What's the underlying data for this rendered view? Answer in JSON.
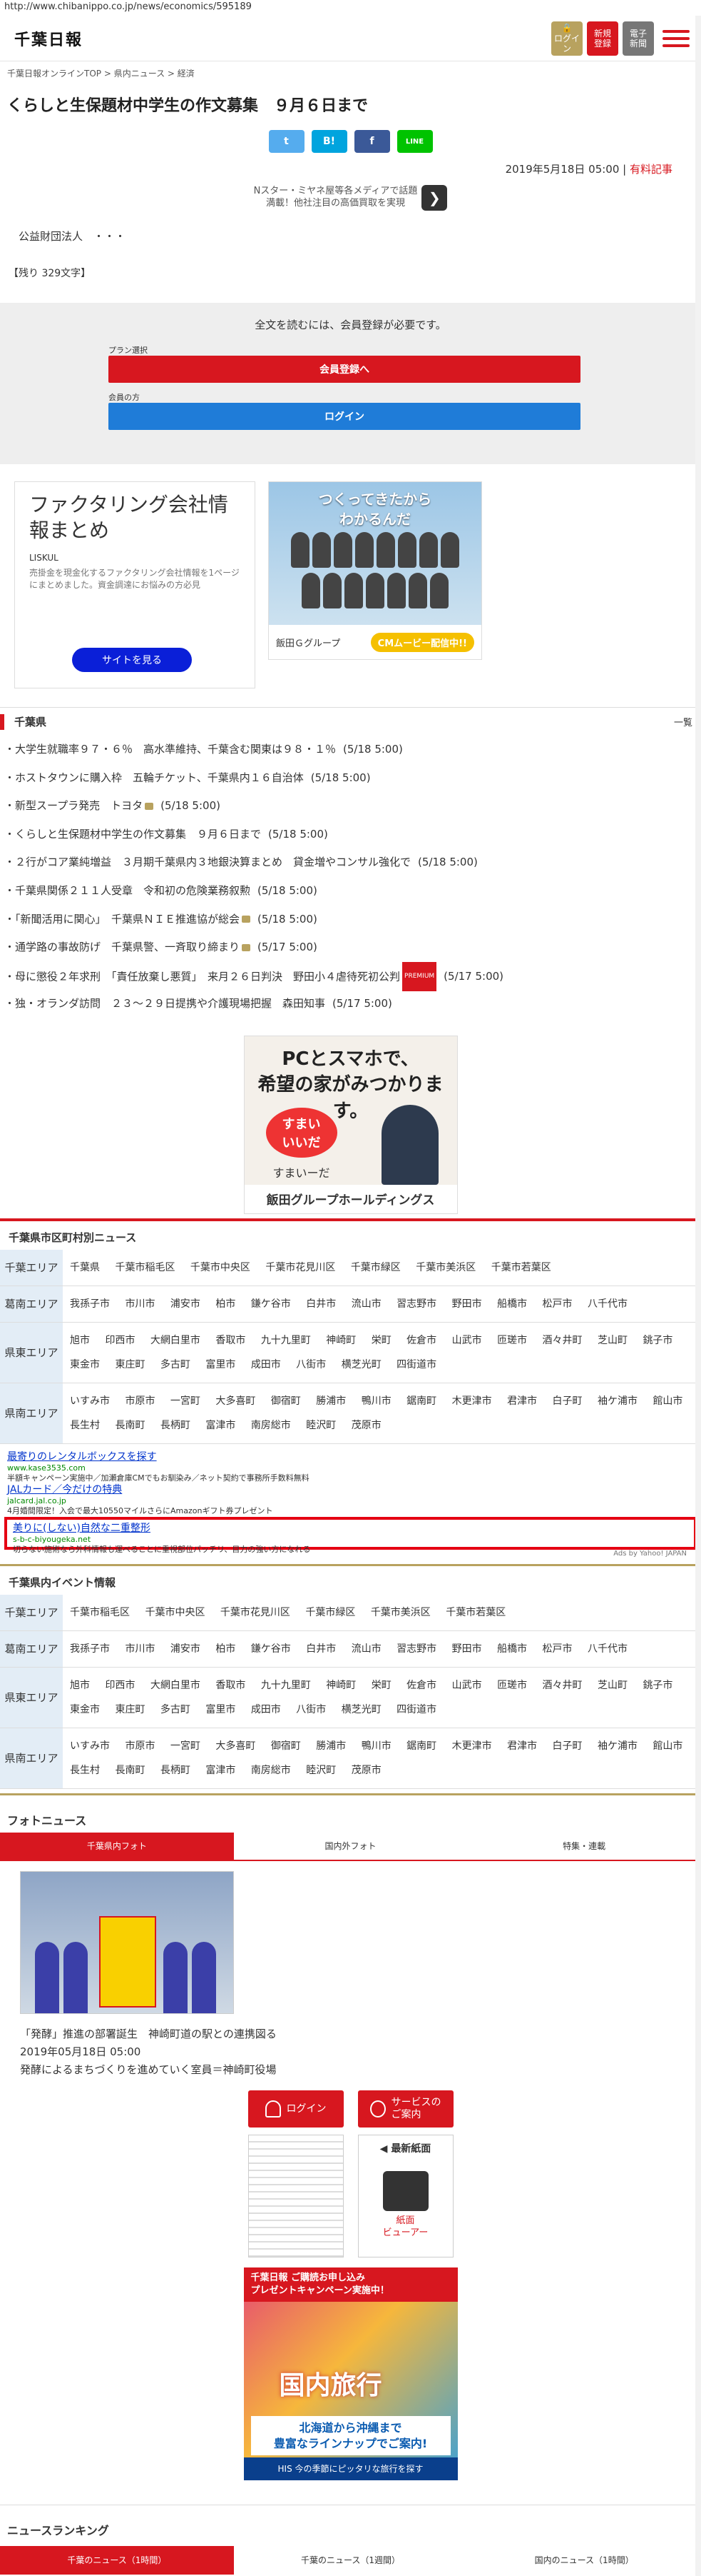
{
  "url": "http://www.chibanippo.co.jp/news/economics/595189",
  "logo": "千葉日報",
  "header": {
    "login": "ログイン",
    "register": "新規\n登録",
    "paper": "電子\n新聞"
  },
  "breadcrumb": "千葉日報オンラインTOP > 県内ニュース > 経済",
  "title": "くらしと生保題材中学生の作文募集　９月６日まで",
  "shares": [
    "t",
    "B!",
    "f",
    "LINE"
  ],
  "date": "2019年5月18日 05:00",
  "paid": "有料記事",
  "top_ad": {
    "line1": "Nスター・ミヤネ屋等各メディアで話題",
    "line2": "満載！他社注目の高価買取を実現"
  },
  "org": "公益財団法人　・・・",
  "remain": "【残り 329文字】",
  "member": {
    "notice": "全文を読むには、会員登録が必要です。",
    "plan_label": "プラン選択",
    "register_btn": "会員登録へ",
    "member_label": "会員の方",
    "login_btn": "ログイン"
  },
  "ad_factoring": {
    "title": "ファクタリング会社情報まとめ",
    "src": "LISKUL",
    "desc": "売掛金を現金化するファクタリング会社情報を1ページにまとめました。資金調達にお悩みの方必見",
    "btn": "サイトを見る"
  },
  "ad_iida": {
    "head": "つくってきたから\nわかるんだ",
    "brand": "飯田Ｇグループ",
    "cm": "CMムービー配信中!!"
  },
  "chiba": {
    "head": "千葉県",
    "more": "一覧",
    "items": [
      {
        "t": "大学生就職率９７・６％　高水準維持、千葉含む関東は９８・１％",
        "d": "(5/18 5:00)",
        "i": ""
      },
      {
        "t": "ホストタウンに購入枠　五輪チケット、千葉県内１６自治体",
        "d": "(5/18 5:00)",
        "i": ""
      },
      {
        "t": "新型スープラ発売　トヨタ",
        "d": "(5/18 5:00)",
        "i": "cam"
      },
      {
        "t": "くらしと生保題材中学生の作文募集　９月６日まで",
        "d": "(5/18 5:00)",
        "i": ""
      },
      {
        "t": "２行がコア業純増益　３月期千葉県内３地銀決算まとめ　貸金増やコンサル強化で",
        "d": "(5/18 5:00)",
        "i": ""
      },
      {
        "t": "千葉県関係２１１人受章　令和初の危険業務叙勲",
        "d": "(5/18 5:00)",
        "i": ""
      },
      {
        "t": "「新聞活用に関心」　千葉県ＮＩＥ推進協が総会",
        "d": "(5/18 5:00)",
        "i": "cam"
      },
      {
        "t": "通学路の事故防げ　千葉県警、一斉取り締まり",
        "d": "(5/17 5:00)",
        "i": "cam"
      },
      {
        "t": "母に懲役２年求刑　「責任放棄し悪質」　来月２６日判決　野田小４虐待死初公判",
        "d": "(5/17 5:00)",
        "i": "premium"
      },
      {
        "t": "独・オランダ訪問　２３～２９日提携や介護現場把握　森田知事",
        "d": "(5/17 5:00)",
        "i": ""
      }
    ],
    "premium": "PREMIUM"
  },
  "ad_iida2": {
    "head": "PCとスマホで、\n希望の家がみつかります。",
    "sumai": "すまい\nいいだ",
    "sumai_txt": "すまいーだ",
    "foot": "飯田グループホールディングス"
  },
  "areas1": {
    "head": "千葉県市区町村別ニュース",
    "rows": [
      {
        "label": "千葉エリア",
        "cells": [
          "千葉県",
          "千葉市稲毛区",
          "千葉市中央区",
          "千葉市花見川区",
          "千葉市緑区",
          "千葉市美浜区",
          "千葉市若葉区"
        ]
      },
      {
        "label": "葛南エリア",
        "cells": [
          "我孫子市",
          "市川市",
          "浦安市",
          "柏市",
          "鎌ケ谷市",
          "白井市",
          "流山市",
          "習志野市",
          "野田市",
          "船橋市",
          "松戸市",
          "八千代市"
        ]
      },
      {
        "label": "県東エリア",
        "cells": [
          "旭市",
          "印西市",
          "大網白里市",
          "香取市",
          "九十九里町",
          "神崎町",
          "栄町",
          "佐倉市",
          "山武市",
          "匝瑳市",
          "酒々井町",
          "芝山町",
          "銚子市",
          "東金市",
          "東庄町",
          "多古町",
          "富里市",
          "成田市",
          "八街市",
          "横芝光町",
          "四街道市"
        ]
      },
      {
        "label": "県南エリア",
        "cells": [
          "いすみ市",
          "市原市",
          "一宮町",
          "大多喜町",
          "御宿町",
          "勝浦市",
          "鴨川市",
          "鋸南町",
          "木更津市",
          "君津市",
          "白子町",
          "袖ケ浦市",
          "館山市",
          "長生村",
          "長南町",
          "長柄町",
          "富津市",
          "南房総市",
          "睦沢町",
          "茂原市"
        ]
      }
    ]
  },
  "yads": [
    {
      "h": "最寄りのレンタルボックスを探す",
      "u": "www.kase3535.com",
      "d": "半額キャンペーン実施中／加瀬倉庫CMでもお馴染み／ネット契約で事務所手数料無料"
    },
    {
      "h": "JALカード／今だけの特典",
      "u": "jalcard.jal.co.jp",
      "d": "4月婚間限定！入会で最大10550マイルさらにAmazonギフト券プレゼント"
    },
    {
      "h": "美りに(しない)自然な二重整形",
      "u": "s-b-c-biyougeka.net",
      "d": "切らない施術なら外科情報も運べることに重視部位パッチリ、目力の強い方になれる"
    }
  ],
  "ads_by": "Ads by Yahoo! JAPAN",
  "areas2": {
    "head": "千葉県内イベント情報",
    "rows": [
      {
        "label": "千葉エリア",
        "cells": [
          "千葉市稲毛区",
          "千葉市中央区",
          "千葉市花見川区",
          "千葉市緑区",
          "千葉市美浜区",
          "千葉市若葉区"
        ]
      },
      {
        "label": "葛南エリア",
        "cells": [
          "我孫子市",
          "市川市",
          "浦安市",
          "柏市",
          "鎌ケ谷市",
          "白井市",
          "流山市",
          "習志野市",
          "野田市",
          "船橋市",
          "松戸市",
          "八千代市"
        ]
      },
      {
        "label": "県東エリア",
        "cells": [
          "旭市",
          "印西市",
          "大網白里市",
          "香取市",
          "九十九里町",
          "神崎町",
          "栄町",
          "佐倉市",
          "山武市",
          "匝瑳市",
          "酒々井町",
          "芝山町",
          "銚子市",
          "東金市",
          "東庄町",
          "多古町",
          "富里市",
          "成田市",
          "八街市",
          "横芝光町",
          "四街道市"
        ]
      },
      {
        "label": "県南エリア",
        "cells": [
          "いすみ市",
          "市原市",
          "一宮町",
          "大多喜町",
          "御宿町",
          "勝浦市",
          "鴨川市",
          "鋸南町",
          "木更津市",
          "君津市",
          "白子町",
          "袖ケ浦市",
          "館山市",
          "長生村",
          "長南町",
          "長柄町",
          "富津市",
          "南房総市",
          "睦沢町",
          "茂原市"
        ]
      }
    ]
  },
  "photo": {
    "head": "フォトニュース",
    "tabs": [
      "千葉県内フォト",
      "国内外フォト",
      "特集・連載"
    ],
    "caption": "「発酵」推進の部署誕生　神崎町道の駅との連携図る",
    "date": "2019年05月18日 05:00",
    "sub": "発酵によるまちづくりを進めていく室員＝神崎町役場"
  },
  "side": {
    "login": "ログイン",
    "service": "サービスの\nご案内",
    "latest": "◀ 最新紙面",
    "viewer": "紙面\nビューアー"
  },
  "subscribe": "千葉日報 ご購読お申し込み\nプレゼントキャンペーン実施中！",
  "his": {
    "h": "国内旅行",
    "sub": "北海道から沖縄まで\n豊富なラインナップでご案内!",
    "f": "HIS 今の季節にピッタリな旅行を探す"
  },
  "ranking": {
    "head": "ニュースランキング",
    "tabs": [
      "千葉のニュース（1時間）",
      "千葉のニュース（1週間）",
      "国内のニュース（1時間）"
    ]
  }
}
